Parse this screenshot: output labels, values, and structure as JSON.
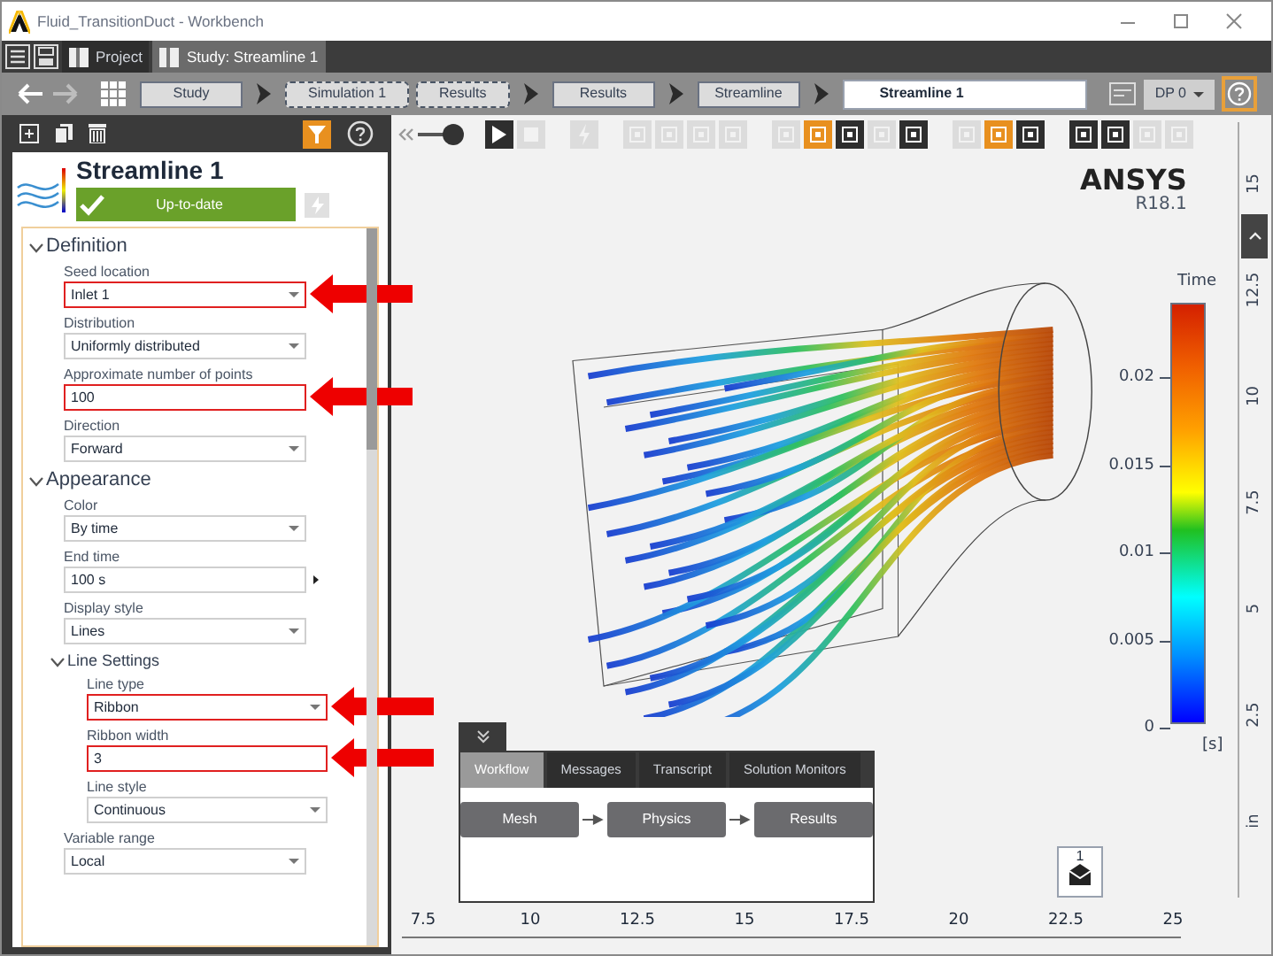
{
  "window": {
    "title": "Fluid_TransitionDuct - Workbench"
  },
  "tabs": [
    {
      "label": "Project",
      "selected": false
    },
    {
      "label": "Study: Streamline 1",
      "selected": true
    }
  ],
  "breadcrumbs": [
    {
      "label": "Study",
      "kind": "step",
      "arrow": true
    },
    {
      "label": "Simulation 1",
      "kind": "group",
      "arrow": false
    },
    {
      "label": "Results",
      "kind": "group",
      "arrow": true
    },
    {
      "label": "Results",
      "kind": "step",
      "arrow": true
    },
    {
      "label": "Streamline",
      "kind": "step",
      "arrow": true
    },
    {
      "label": "Streamline 1",
      "kind": "current",
      "arrow": false
    }
  ],
  "design_point": {
    "label": "DP 0"
  },
  "panel": {
    "title": "Streamline 1",
    "status": "Up-to-date",
    "sections": [
      {
        "title": "Definition",
        "expanded": true,
        "fields": [
          {
            "kind": "dropdown",
            "label": "Seed location",
            "value": "Inlet 1",
            "highlighted": true
          },
          {
            "kind": "dropdown",
            "label": "Distribution",
            "value": "Uniformly distributed",
            "highlighted": false
          },
          {
            "kind": "text",
            "label": "Approximate number of points",
            "value": "100",
            "highlighted": true
          },
          {
            "kind": "dropdown",
            "label": "Direction",
            "value": "Forward",
            "highlighted": false
          }
        ]
      },
      {
        "title": "Appearance",
        "expanded": true,
        "fields": [
          {
            "kind": "dropdown",
            "label": "Color",
            "value": "By time",
            "highlighted": false
          },
          {
            "kind": "textmenu",
            "label": "End time",
            "value": "100 s",
            "highlighted": false
          },
          {
            "kind": "dropdown",
            "label": "Display style",
            "value": "Lines",
            "highlighted": false
          },
          {
            "kind": "group",
            "label": "Line Settings",
            "expanded": true,
            "children": [
              {
                "kind": "dropdown",
                "label": "Line type",
                "value": "Ribbon",
                "highlighted": true
              },
              {
                "kind": "text",
                "label": "Ribbon width",
                "value": "3",
                "highlighted": true
              },
              {
                "kind": "dropdown",
                "label": "Line style",
                "value": "Continuous",
                "highlighted": false
              }
            ]
          },
          {
            "kind": "dropdown",
            "label": "Variable range",
            "value": "Local",
            "highlighted": false
          }
        ]
      }
    ]
  },
  "viewport_toolbar": {
    "slider": {
      "level": 1
    },
    "tool_groups": [
      [
        {
          "kind": "play",
          "selected": false,
          "disabled": false
        },
        {
          "kind": "stop",
          "selected": false,
          "disabled": true
        }
      ],
      [
        {
          "kind": "bolt",
          "selected": false,
          "disabled": true
        }
      ],
      [
        {
          "kind": "tool",
          "selected": false,
          "disabled": true
        },
        {
          "kind": "tool",
          "selected": false,
          "disabled": true
        },
        {
          "kind": "tool",
          "selected": false,
          "disabled": true
        },
        {
          "kind": "tool",
          "selected": false,
          "disabled": true
        }
      ],
      [
        {
          "kind": "tool",
          "selected": false,
          "disabled": true
        },
        {
          "kind": "tool",
          "selected": true,
          "disabled": false
        },
        {
          "kind": "tool",
          "selected": false,
          "disabled": false
        },
        {
          "kind": "tool",
          "selected": false,
          "disabled": true
        },
        {
          "kind": "tool",
          "selected": false,
          "disabled": false
        }
      ],
      [
        {
          "kind": "tool",
          "selected": false,
          "disabled": true
        },
        {
          "kind": "tool",
          "selected": true,
          "disabled": false
        },
        {
          "kind": "tool",
          "selected": false,
          "disabled": false
        }
      ],
      [
        {
          "kind": "tool",
          "selected": false,
          "disabled": false
        },
        {
          "kind": "tool",
          "selected": false,
          "disabled": false
        },
        {
          "kind": "tool",
          "selected": false,
          "disabled": true
        },
        {
          "kind": "tool",
          "selected": false,
          "disabled": true
        }
      ]
    ]
  },
  "logo": {
    "name": "ANSYS",
    "version": "R18.1"
  },
  "legend": {
    "title": "Time",
    "unit": "[s]",
    "ticks": [
      "0.02",
      "0.015",
      "0.01",
      "0.005",
      "0"
    ]
  },
  "vertical_ruler": [
    "15",
    "12.5",
    "10",
    "7.5",
    "5",
    "2.5",
    "in"
  ],
  "horizontal_ruler": [
    "7.5",
    "10",
    "12.5",
    "15",
    "17.5",
    "20",
    "22.5",
    "25"
  ],
  "notifications": {
    "count": "1"
  },
  "bottom_panel": {
    "tabs": [
      {
        "label": "Workflow",
        "selected": true
      },
      {
        "label": "Messages",
        "selected": false
      },
      {
        "label": "Transcript",
        "selected": false
      },
      {
        "label": "Solution Monitors",
        "selected": false
      }
    ],
    "workflow": [
      "Mesh",
      "Physics",
      "Results"
    ]
  }
}
